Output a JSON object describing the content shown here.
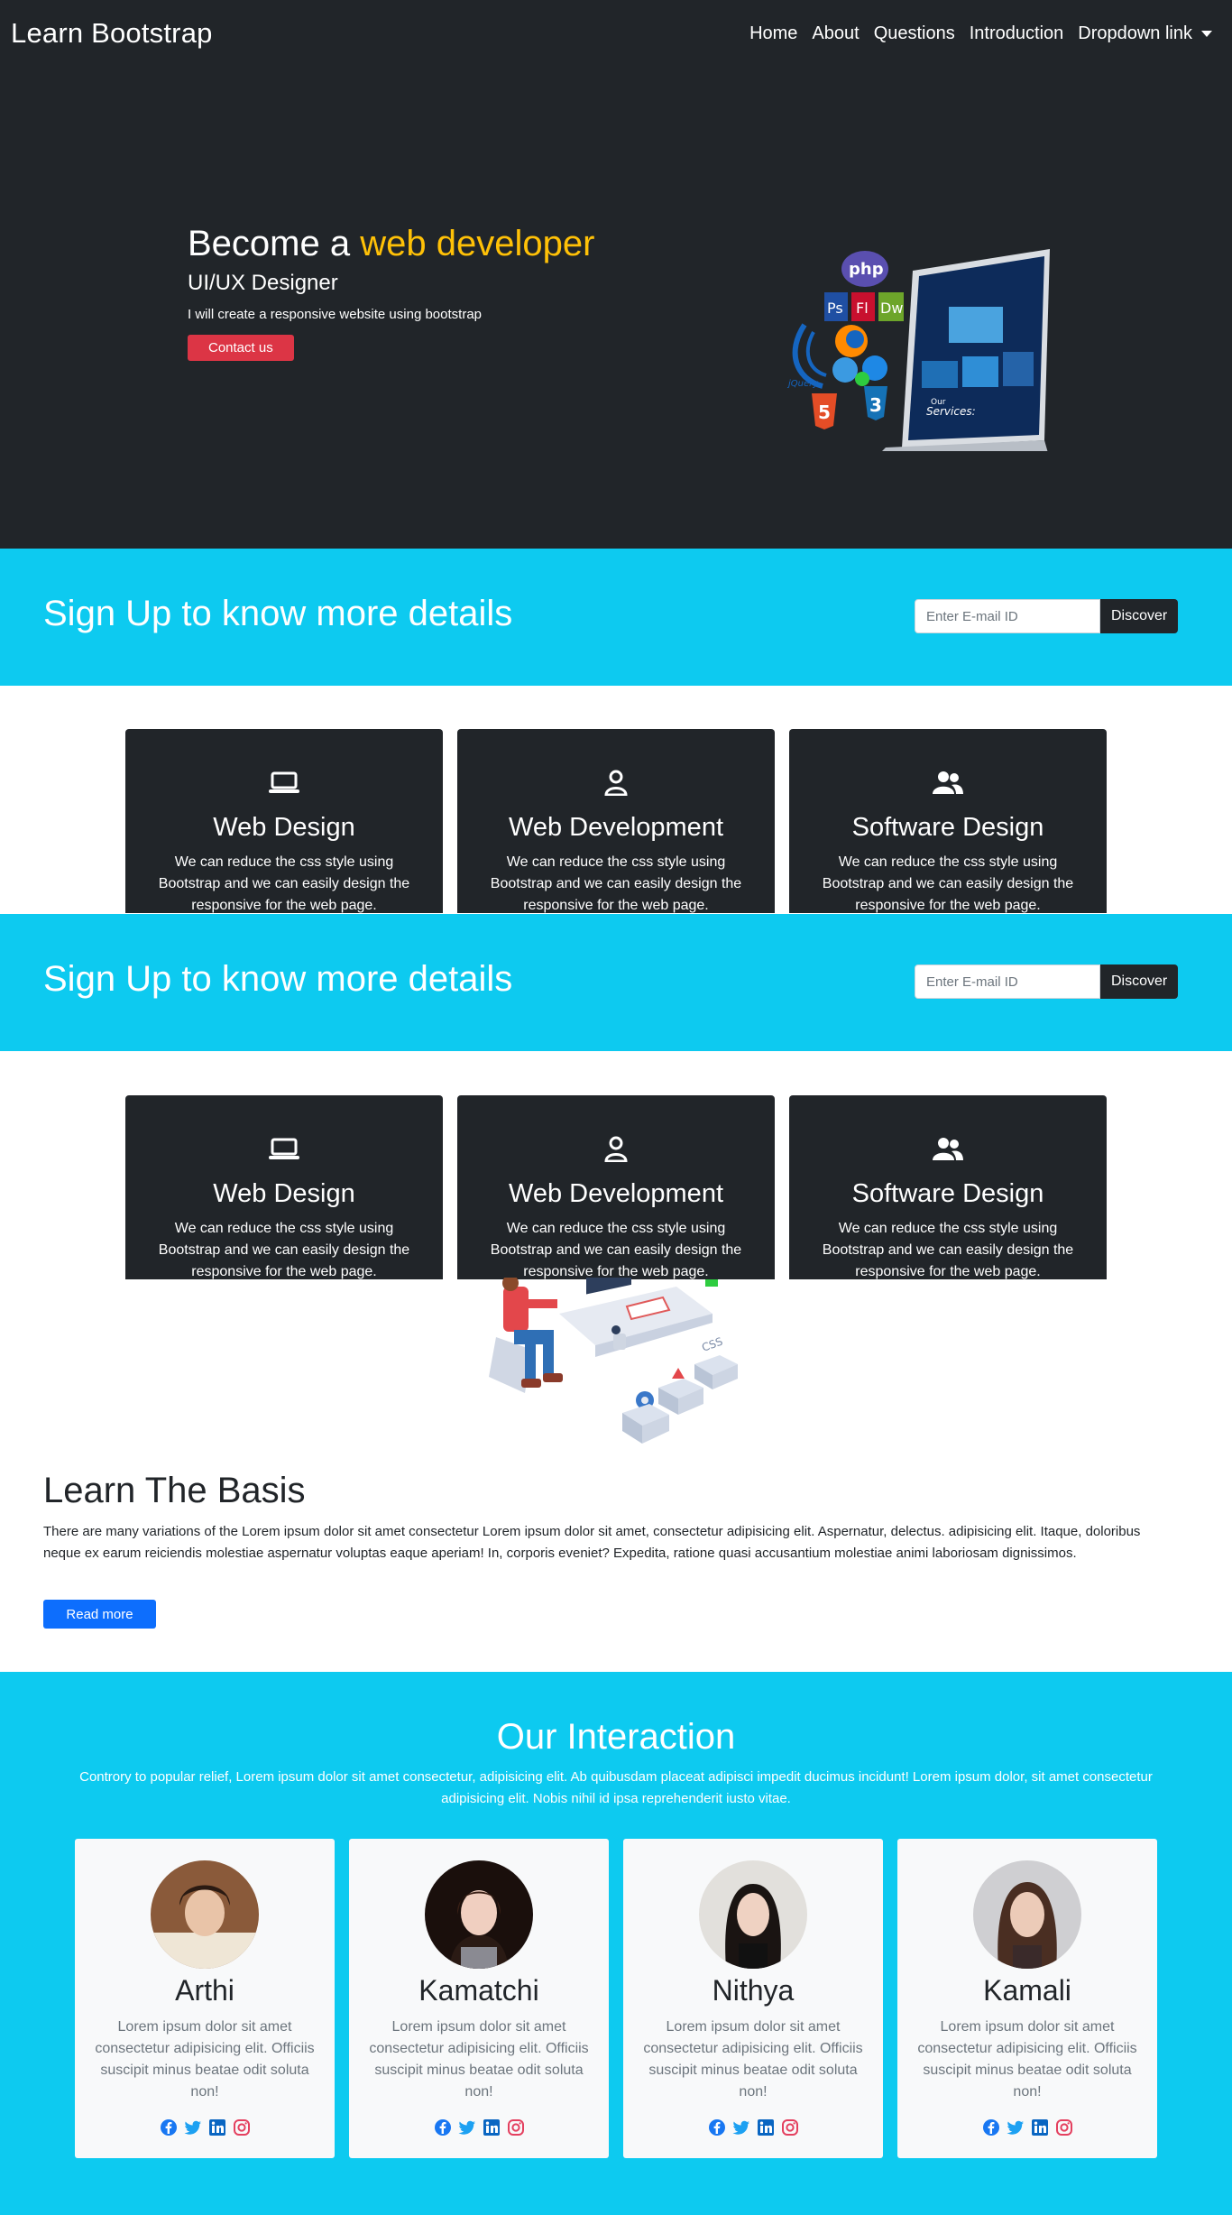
{
  "navbar": {
    "brand": "Learn Bootstrap",
    "items": [
      "Home",
      "About",
      "Questions",
      "Introduction",
      "Dropdown link"
    ]
  },
  "hero": {
    "title_prefix": "Become a",
    "title_accent": "web developer",
    "subtitle": "UI/UX Designer",
    "description": "I will create a responsive website using bootstrap",
    "button": "Contact us",
    "art_labels": {
      "php": "php",
      "ps": "Ps",
      "fl": "Fl",
      "dw": "Dw",
      "jquery": "jQuery",
      "html5": "5",
      "css3": "3",
      "services": "Services:",
      "our": "Our"
    }
  },
  "signup": {
    "title": "Sign Up to know more details",
    "placeholder": "Enter E-mail ID",
    "button": "Discover"
  },
  "services": [
    {
      "icon": "laptop-icon",
      "title": "Web Design",
      "text": "We can reduce the css style using Bootstrap and we can easily design the responsive for the web page."
    },
    {
      "icon": "person-icon",
      "title": "Web Development",
      "text": "We can reduce the css style using Bootstrap and we can easily design the responsive for the web page."
    },
    {
      "icon": "people-icon",
      "title": "Software Design",
      "text": "We can reduce the css style using Bootstrap and we can easily design the responsive for the web page."
    }
  ],
  "learn": {
    "illustration_label": "CSS",
    "title": "Learn The Basis",
    "text": "There are many variations of the Lorem ipsum dolor sit amet consectetur Lorem ipsum dolor sit amet, consectetur adipisicing elit. Aspernatur, delectus. adipisicing elit. Itaque, doloribus neque ex earum reiciendis molestiae aspernatur voluptas eaque aperiam! In, corporis eveniet? Expedita, ratione quasi accusantium molestiae animi laboriosam dignissimos.",
    "button": "Read more"
  },
  "interaction": {
    "title": "Our Interaction",
    "text": "Controry to popular relief, Lorem ipsum dolor sit amet consectetur, adipisicing elit. Ab quibusdam placeat adipisci impedit ducimus incidunt! Lorem ipsum dolor, sit amet consectetur adipisicing elit. Nobis nihil id ipsa reprehenderit iusto vitae.",
    "people": [
      {
        "name": "Arthi",
        "text": "Lorem ipsum dolor sit amet consectetur adipisicing elit. Officiis suscipit minus beatae odit soluta non!"
      },
      {
        "name": "Kamatchi",
        "text": "Lorem ipsum dolor sit amet consectetur adipisicing elit. Officiis suscipit minus beatae odit soluta non!"
      },
      {
        "name": "Nithya",
        "text": "Lorem ipsum dolor sit amet consectetur adipisicing elit. Officiis suscipit minus beatae odit soluta non!"
      },
      {
        "name": "Kamali",
        "text": "Lorem ipsum dolor sit amet consectetur adipisicing elit. Officiis suscipit minus beatae odit soluta non!"
      }
    ],
    "social_icons": [
      "facebook-icon",
      "twitter-icon",
      "linkedin-icon",
      "instagram-icon"
    ]
  },
  "colors": {
    "dark": "#212529",
    "accent": "#ffc107",
    "info": "#0dcaf0",
    "danger": "#dc3545",
    "primary": "#0d6efd",
    "facebook": "#1877f2",
    "twitter": "#1da1f2",
    "linkedin": "#0a66c2",
    "instagram": "#e4405f"
  }
}
